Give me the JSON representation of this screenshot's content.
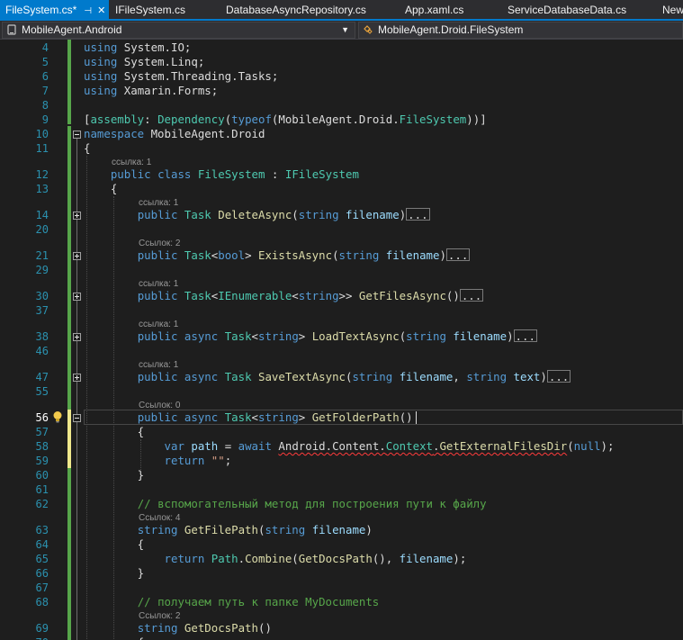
{
  "tabs": [
    {
      "label": "FileSystem.cs*",
      "active": true
    },
    {
      "label": "IFileSystem.cs"
    },
    {
      "label": "DatabaseAsyncRepository.cs"
    },
    {
      "label": "App.xaml.cs"
    },
    {
      "label": "ServiceDatabaseData.cs"
    },
    {
      "label": "New"
    }
  ],
  "navbar": {
    "project": "MobileAgent.Android",
    "type": "MobileAgent.Droid.FileSystem"
  },
  "colors": {
    "accent": "#007acc",
    "change_bar_saved": "#57a64a",
    "change_bar_unsaved": "#efe88c",
    "background": "#1e1e1e",
    "line_number": "#2b91af"
  },
  "icons": [
    "pin-icon",
    "close-icon",
    "project-icon",
    "class-icon",
    "chevron-down-icon",
    "lightbulb-icon",
    "fold-toggle-icon"
  ],
  "editor": {
    "current_line": "56",
    "lines": [
      {
        "n": "4",
        "code": [
          {
            "k": "k",
            "t": "using"
          },
          {
            "t": " System.IO;"
          }
        ]
      },
      {
        "n": "5",
        "code": [
          {
            "k": "k",
            "t": "using"
          },
          {
            "t": " System.Linq;"
          }
        ]
      },
      {
        "n": "6",
        "code": [
          {
            "k": "k",
            "t": "using"
          },
          {
            "t": " System.Threading.Tasks;"
          }
        ]
      },
      {
        "n": "7",
        "code": [
          {
            "k": "k",
            "t": "using"
          },
          {
            "t": " Xamarin.Forms;"
          }
        ]
      },
      {
        "n": "8",
        "code": []
      },
      {
        "n": "9",
        "code": [
          {
            "t": "["
          },
          {
            "k": "t",
            "t": "assembly"
          },
          {
            "t": ": "
          },
          {
            "k": "t",
            "t": "Dependency"
          },
          {
            "t": "("
          },
          {
            "k": "k",
            "t": "typeof"
          },
          {
            "t": "(MobileAgent.Droid."
          },
          {
            "k": "t",
            "t": "FileSystem"
          },
          {
            "t": "))]"
          }
        ]
      },
      {
        "n": "10",
        "code": [
          {
            "k": "k",
            "t": "namespace"
          },
          {
            "t": " MobileAgent.Droid"
          }
        ]
      },
      {
        "n": "11",
        "code": [
          {
            "t": "{"
          }
        ]
      },
      {
        "n": "12",
        "lens": "ссылка: 1",
        "code": [
          {
            "t": "    "
          },
          {
            "k": "k",
            "t": "public"
          },
          {
            "t": " "
          },
          {
            "k": "k",
            "t": "class"
          },
          {
            "t": " "
          },
          {
            "k": "t",
            "t": "FileSystem"
          },
          {
            "t": " : "
          },
          {
            "k": "t",
            "t": "IFileSystem"
          }
        ]
      },
      {
        "n": "13",
        "code": [
          {
            "t": "    {"
          }
        ]
      },
      {
        "n": "14",
        "lens": "ссылка: 1",
        "code": [
          {
            "t": "        "
          },
          {
            "k": "k",
            "t": "public"
          },
          {
            "t": " "
          },
          {
            "k": "t",
            "t": "Task"
          },
          {
            "t": " "
          },
          {
            "k": "m",
            "t": "DeleteAsync"
          },
          {
            "t": "("
          },
          {
            "k": "k",
            "t": "string"
          },
          {
            "t": " "
          },
          {
            "k": "p",
            "t": "filename"
          },
          {
            "t": ")"
          }
        ],
        "collapsed": "..."
      },
      {
        "n": "20",
        "code": []
      },
      {
        "n": "21",
        "lens": "Ссылок: 2",
        "code": [
          {
            "t": "        "
          },
          {
            "k": "k",
            "t": "public"
          },
          {
            "t": " "
          },
          {
            "k": "t",
            "t": "Task"
          },
          {
            "t": "<"
          },
          {
            "k": "k",
            "t": "bool"
          },
          {
            "t": "> "
          },
          {
            "k": "m",
            "t": "ExistsAsync"
          },
          {
            "t": "("
          },
          {
            "k": "k",
            "t": "string"
          },
          {
            "t": " "
          },
          {
            "k": "p",
            "t": "filename"
          },
          {
            "t": ")"
          }
        ],
        "collapsed": "..."
      },
      {
        "n": "29",
        "code": []
      },
      {
        "n": "30",
        "lens": "ссылка: 1",
        "code": [
          {
            "t": "        "
          },
          {
            "k": "k",
            "t": "public"
          },
          {
            "t": " "
          },
          {
            "k": "t",
            "t": "Task"
          },
          {
            "t": "<"
          },
          {
            "k": "t",
            "t": "IEnumerable"
          },
          {
            "t": "<"
          },
          {
            "k": "k",
            "t": "string"
          },
          {
            "t": ">> "
          },
          {
            "k": "m",
            "t": "GetFilesAsync"
          },
          {
            "t": "()"
          }
        ],
        "collapsed": "..."
      },
      {
        "n": "37",
        "code": []
      },
      {
        "n": "38",
        "lens": "ссылка: 1",
        "code": [
          {
            "t": "        "
          },
          {
            "k": "k",
            "t": "public"
          },
          {
            "t": " "
          },
          {
            "k": "k",
            "t": "async"
          },
          {
            "t": " "
          },
          {
            "k": "t",
            "t": "Task"
          },
          {
            "t": "<"
          },
          {
            "k": "k",
            "t": "string"
          },
          {
            "t": "> "
          },
          {
            "k": "m",
            "t": "LoadTextAsync"
          },
          {
            "t": "("
          },
          {
            "k": "k",
            "t": "string"
          },
          {
            "t": " "
          },
          {
            "k": "p",
            "t": "filename"
          },
          {
            "t": ")"
          }
        ],
        "collapsed": "..."
      },
      {
        "n": "46",
        "code": []
      },
      {
        "n": "47",
        "lens": "ссылка: 1",
        "code": [
          {
            "t": "        "
          },
          {
            "k": "k",
            "t": "public"
          },
          {
            "t": " "
          },
          {
            "k": "k",
            "t": "async"
          },
          {
            "t": " "
          },
          {
            "k": "t",
            "t": "Task"
          },
          {
            "t": " "
          },
          {
            "k": "m",
            "t": "SaveTextAsync"
          },
          {
            "t": "("
          },
          {
            "k": "k",
            "t": "string"
          },
          {
            "t": " "
          },
          {
            "k": "p",
            "t": "filename"
          },
          {
            "t": ", "
          },
          {
            "k": "k",
            "t": "string"
          },
          {
            "t": " "
          },
          {
            "k": "p",
            "t": "text"
          },
          {
            "t": ")"
          }
        ],
        "collapsed": "..."
      },
      {
        "n": "55",
        "code": []
      },
      {
        "n": "56",
        "lens": "Ссылок: 0",
        "code": [
          {
            "t": "        "
          },
          {
            "k": "k",
            "t": "public"
          },
          {
            "t": " "
          },
          {
            "k": "k",
            "t": "async"
          },
          {
            "t": " "
          },
          {
            "k": "t",
            "t": "Task"
          },
          {
            "t": "<"
          },
          {
            "k": "k",
            "t": "string"
          },
          {
            "t": "> "
          },
          {
            "k": "m",
            "t": "GetFolderPath"
          },
          {
            "t": "()"
          }
        ],
        "caret": true
      },
      {
        "n": "57",
        "code": [
          {
            "t": "        {"
          }
        ]
      },
      {
        "n": "58",
        "code": [
          {
            "t": "            "
          },
          {
            "k": "k",
            "t": "var"
          },
          {
            "t": " "
          },
          {
            "k": "p",
            "t": "path"
          },
          {
            "t": " = "
          },
          {
            "k": "k",
            "t": "await"
          },
          {
            "t": " "
          },
          {
            "k": "err",
            "t": "Android.Content."
          },
          {
            "k": "err t",
            "t": "Context"
          },
          {
            "k": "err",
            "t": "."
          },
          {
            "k": "err m",
            "t": "GetExternalFilesDir"
          },
          {
            "t": "("
          },
          {
            "k": "k",
            "t": "null"
          },
          {
            "t": ");"
          }
        ]
      },
      {
        "n": "59",
        "code": [
          {
            "t": "            "
          },
          {
            "k": "k",
            "t": "return"
          },
          {
            "t": " "
          },
          {
            "k": "s",
            "t": "\"\""
          },
          {
            "t": ";"
          }
        ]
      },
      {
        "n": "60",
        "code": [
          {
            "t": "        }"
          }
        ]
      },
      {
        "n": "61",
        "code": []
      },
      {
        "n": "62",
        "code": [
          {
            "t": "        "
          },
          {
            "k": "c",
            "t": "// вспомогательный метод для построения пути к файлу"
          }
        ]
      },
      {
        "n": "63",
        "lens": "Ссылок: 4",
        "code": [
          {
            "t": "        "
          },
          {
            "k": "k",
            "t": "string"
          },
          {
            "t": " "
          },
          {
            "k": "m",
            "t": "GetFilePath"
          },
          {
            "t": "("
          },
          {
            "k": "k",
            "t": "string"
          },
          {
            "t": " "
          },
          {
            "k": "p",
            "t": "filename"
          },
          {
            "t": ")"
          }
        ]
      },
      {
        "n": "64",
        "code": [
          {
            "t": "        {"
          }
        ]
      },
      {
        "n": "65",
        "code": [
          {
            "t": "            "
          },
          {
            "k": "k",
            "t": "return"
          },
          {
            "t": " "
          },
          {
            "k": "t",
            "t": "Path"
          },
          {
            "t": "."
          },
          {
            "k": "m",
            "t": "Combine"
          },
          {
            "t": "("
          },
          {
            "k": "m",
            "t": "GetDocsPath"
          },
          {
            "t": "(), "
          },
          {
            "k": "p",
            "t": "filename"
          },
          {
            "t": ");"
          }
        ]
      },
      {
        "n": "66",
        "code": [
          {
            "t": "        }"
          }
        ]
      },
      {
        "n": "67",
        "code": []
      },
      {
        "n": "68",
        "code": [
          {
            "t": "        "
          },
          {
            "k": "c",
            "t": "// получаем путь к папке MyDocuments"
          }
        ]
      },
      {
        "n": "69",
        "lens": "Ссылок: 2",
        "code": [
          {
            "t": "        "
          },
          {
            "k": "k",
            "t": "string"
          },
          {
            "t": " "
          },
          {
            "k": "m",
            "t": "GetDocsPath"
          },
          {
            "t": "()"
          }
        ]
      },
      {
        "n": "70",
        "code": [
          {
            "t": "        {"
          }
        ]
      }
    ]
  }
}
